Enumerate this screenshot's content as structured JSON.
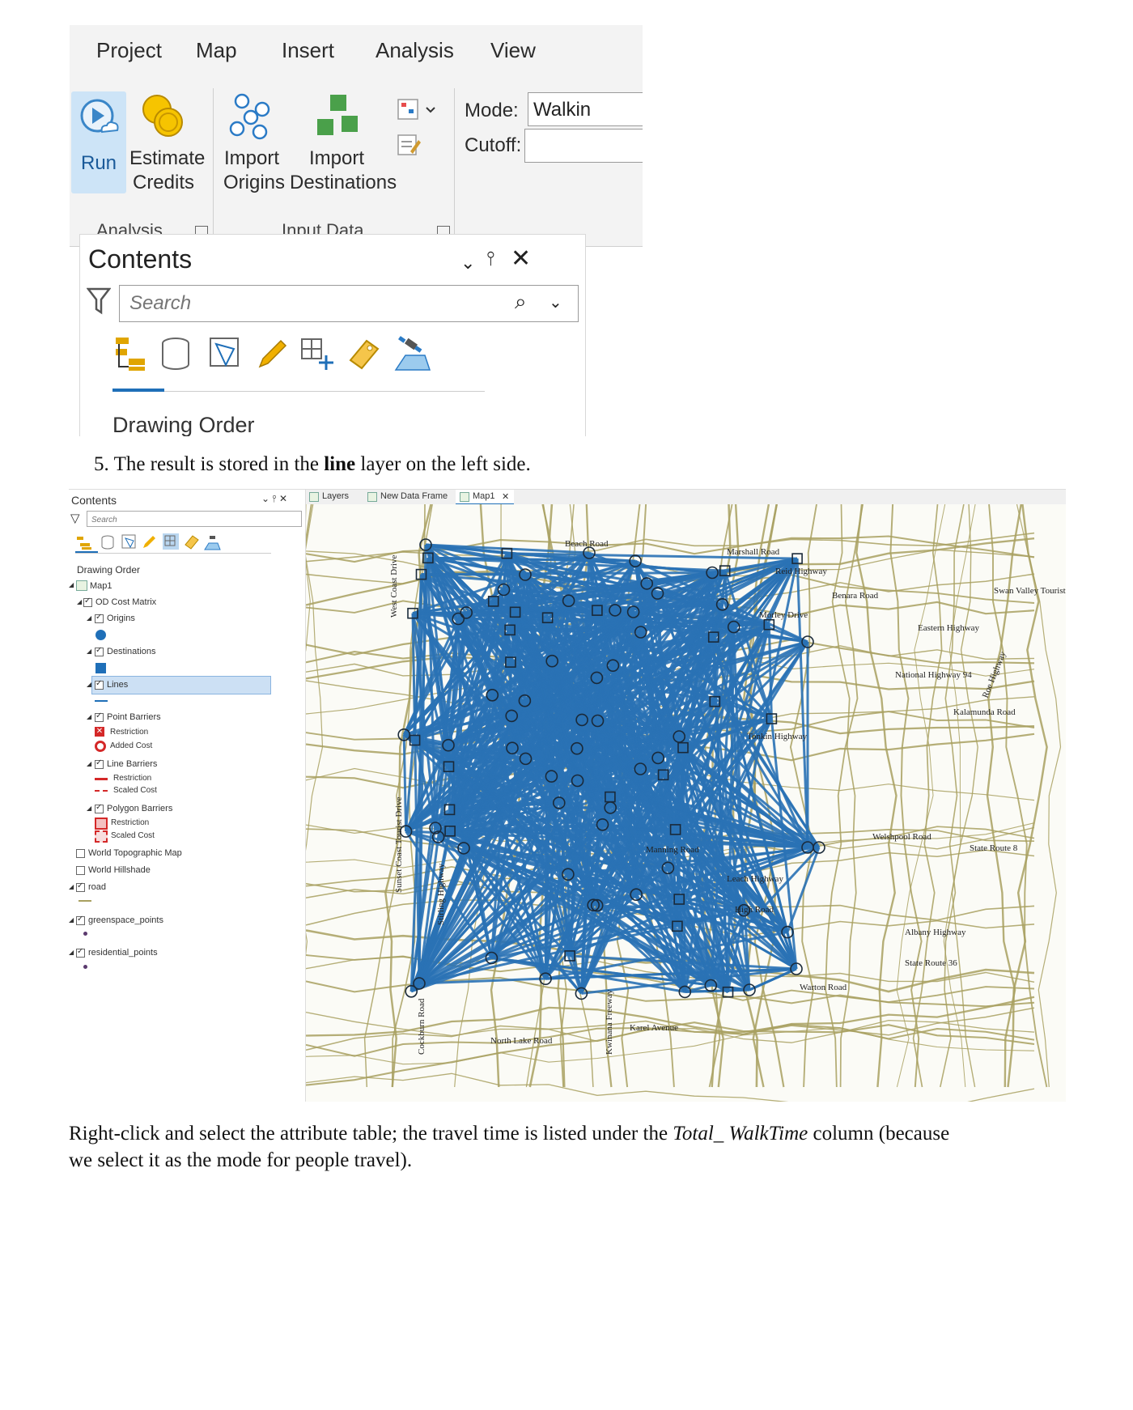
{
  "ribbon": {
    "tabs": [
      "Project",
      "Map",
      "Insert",
      "Analysis",
      "View"
    ],
    "run_label": "Run",
    "estimate_label_1": "Estimate",
    "estimate_label_2": "Credits",
    "import_origins_1": "Import",
    "import_origins_2": "Origins",
    "import_dest_1": "Import",
    "import_dest_2": "Destinations",
    "group_analysis": "Analysis",
    "group_input": "Input Data",
    "mode_label": "Mode:",
    "mode_value": "Walkin",
    "cutoff_label": "Cutoff:",
    "cutoff_value": ""
  },
  "contents": {
    "title": "Contents",
    "search_placeholder": "Search",
    "drawing_order": "Drawing Order"
  },
  "caption1": {
    "number": "5.",
    "pre": "The result is stored in the",
    "bold": "line",
    "post": "layer on the left side."
  },
  "toc": {
    "title": "Contents",
    "search_placeholder": "Search",
    "drawing_order": "Drawing Order",
    "items": {
      "map": "Map1",
      "od": "OD Cost Matrix",
      "origins": "Origins",
      "destinations": "Destinations",
      "lines": "Lines",
      "point_barriers": "Point Barriers",
      "pb_restriction": "Restriction",
      "pb_added": "Added Cost",
      "line_barriers": "Line Barriers",
      "lb_restriction": "Restriction",
      "lb_scaled": "Scaled Cost",
      "polygon_barriers": "Polygon Barriers",
      "pg_restriction": "Restriction",
      "pg_scaled": "Scaled Cost",
      "topo": "World Topographic Map",
      "hillshade": "World Hillshade",
      "road": "road",
      "greenspace": "greenspace_points",
      "residential": "residential_points"
    }
  },
  "map_tabs": [
    "Layers",
    "New Data Frame",
    "Map1"
  ],
  "map_labels": {
    "beach_road": "Beach Road",
    "marshall": "Marshall Road",
    "reid": "Reid Highway",
    "benara": "Benara Road",
    "morley": "Morley Drive",
    "eastern": "Eastern Highway",
    "national": "National Highway 94",
    "tonkin": "Tonkin Highway",
    "welshpool": "Welshpool Road",
    "state8": "State Route 8",
    "state36": "State Route 36",
    "albany": "Albany Highway",
    "leach": "Leach Highway",
    "high": "High Road",
    "manning": "Manning Road",
    "kwinana": "Kwinana Freeway",
    "cockburn": "Cockburn Road",
    "north_lake": "North Lake Road",
    "sunset": "Sunset Coast Tourist Drive",
    "west_coast": "West Coast Drive",
    "stirling": "Stirling Highway",
    "swan_valley": "Swan Valley Tourist Drive",
    "roe": "Roe Highway",
    "kalamunda": "Kalamunda Road",
    "warton": "Warton Road",
    "karel": "Karel Avenue"
  },
  "caption2": {
    "pre": "Right-click and select the attribute table; the travel time is listed under the",
    "italic": "Total_ WalkTime",
    "post": "column (because",
    "line2": "we select it as the mode for people travel)."
  },
  "colors": {
    "accent": "#1f6fb8",
    "lines": "#2a72b5",
    "roads": "#a8a060"
  }
}
